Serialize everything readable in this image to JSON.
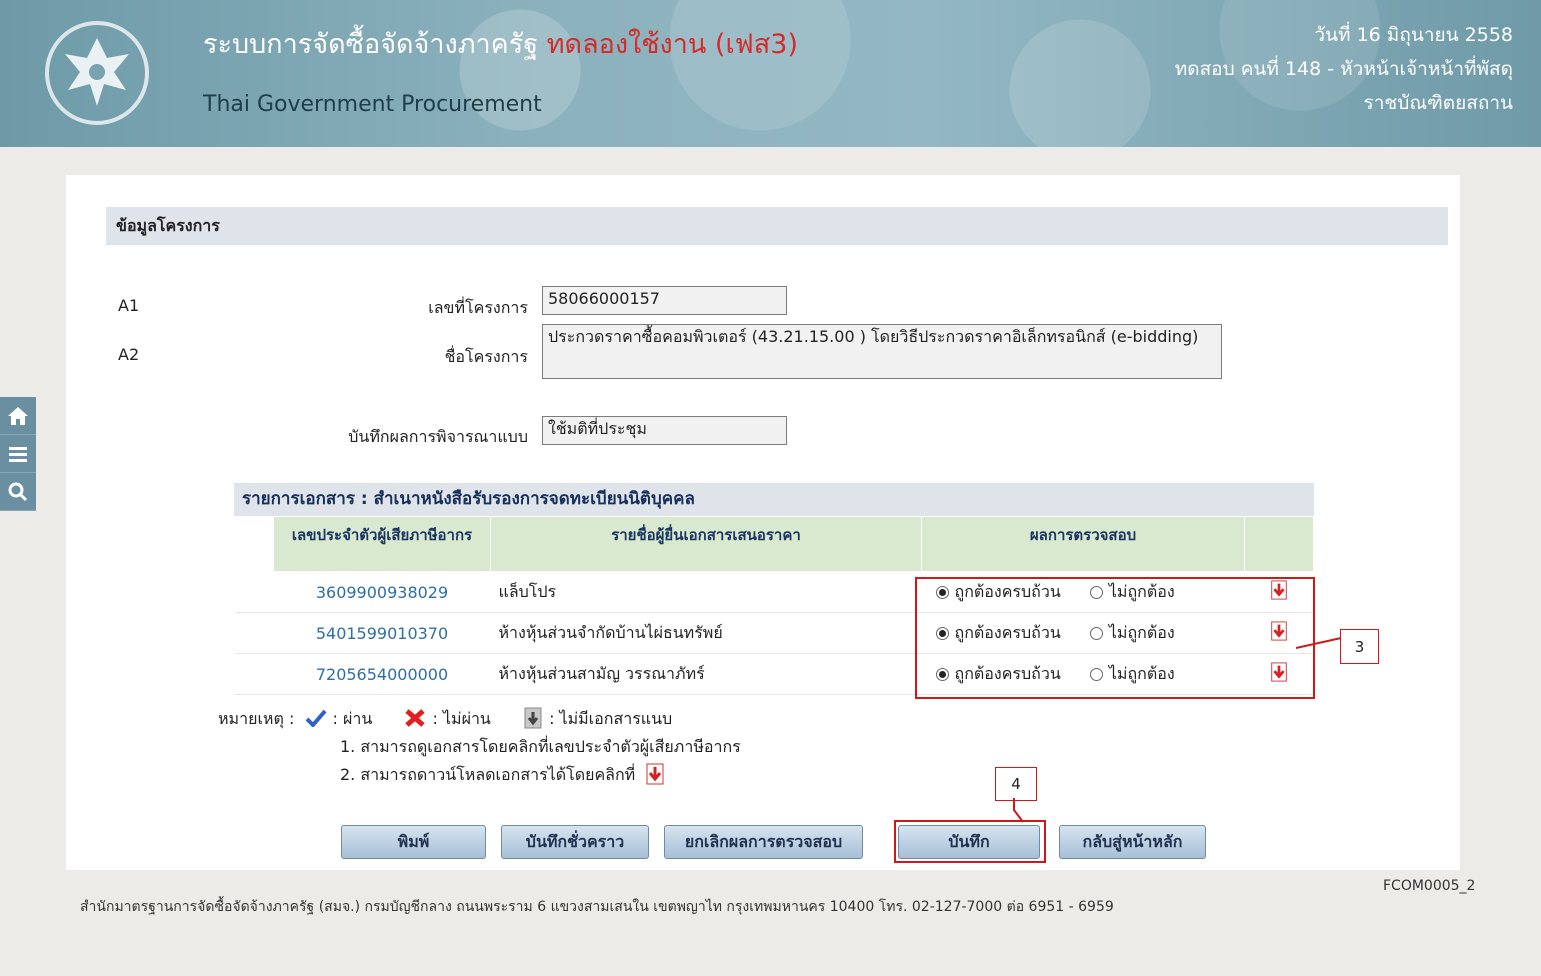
{
  "header": {
    "title": "ระบบการจัดซื้อจัดจ้างภาครัฐ",
    "trial": "ทดลองใช้งาน (เฟส3)",
    "subtitle": "Thai Government Procurement",
    "date": "วันที่ 16 มิถุนายน 2558",
    "user": "ทดสอบ คนที่ 148 - หัวหน้าเจ้าหน้าที่พัสดุ",
    "org": "ราชบัณฑิตยสถาน"
  },
  "sidebar": {
    "icons": [
      "home-icon",
      "menu-icon",
      "search-icon"
    ]
  },
  "section": {
    "title": "ข้อมูลโครงการ"
  },
  "project": {
    "a1_code": "A1",
    "a1_label": "เลขที่โครงการ",
    "a1_value": "58066000157",
    "a2_code": "A2",
    "a2_label": "ชื่อโครงการ",
    "a2_value": "ประกวดราคาซื้อคอมพิวเตอร์ (43.21.15.00 ) โดยวิธีประกวดราคาอิเล็กทรอนิกส์ (e-bidding)",
    "result_label": "บันทึกผลการพิจารณาแบบ",
    "result_value": "ใช้มติที่ประชุม"
  },
  "documents": {
    "title": "รายการเอกสาร : สำเนาหนังสือรับรองการจดทะเบียนนิติบุคคล",
    "headers": [
      "เลขประจำตัวผู้เสียภาษีอากร",
      "รายชื่อผู้ยื่นเอกสารเสนอราคา",
      "ผลการตรวจสอบ"
    ],
    "radio_ok": "ถูกต้องครบถ้วน",
    "radio_bad": "ไม่ถูกต้อง",
    "rows": [
      {
        "tax_id": "3609900938029",
        "name": "แล็บโปร",
        "selected": "ok"
      },
      {
        "tax_id": "5401599010370",
        "name": "ห้างหุ้นส่วนจำกัดบ้านไผ่ธนทรัพย์",
        "selected": "ok"
      },
      {
        "tax_id": "7205654000000",
        "name": "ห้างหุ้นส่วนสามัญ วรรณาภัทร์",
        "selected": "ok"
      }
    ]
  },
  "notes": {
    "label": "หมายเหตุ :",
    "pass": ": ผ่าน",
    "fail": ": ไม่ผ่าน",
    "no_attach": ": ไม่มีเอกสารแนบ",
    "line1": "1. สามารถดูเอกสารโดยคลิกที่เลขประจำตัวผู้เสียภาษีอากร",
    "line2": "2. สามารถดาวน์โหลดเอกสารได้โดยคลิกที่"
  },
  "callouts": {
    "c3": "3",
    "c4": "4"
  },
  "buttons": {
    "print": "พิมพ์",
    "draft": "บันทึกชั่วคราว",
    "cancel": "ยกเลิกผลการตรวจสอบ",
    "save": "บันทึก",
    "home": "กลับสู่หน้าหลัก"
  },
  "footer": {
    "text": "สำนักมาตรฐานการจัดซื้อจัดจ้างภาครัฐ (สมจ.) กรมบัญชีกลาง ถนนพระราม 6 แขวงสามเสนใน เขตพญาไท กรุงเทพมหานคร 10400 โทร. 02-127-7000 ต่อ 6951 - 6959",
    "code": "FCOM0005_2"
  }
}
